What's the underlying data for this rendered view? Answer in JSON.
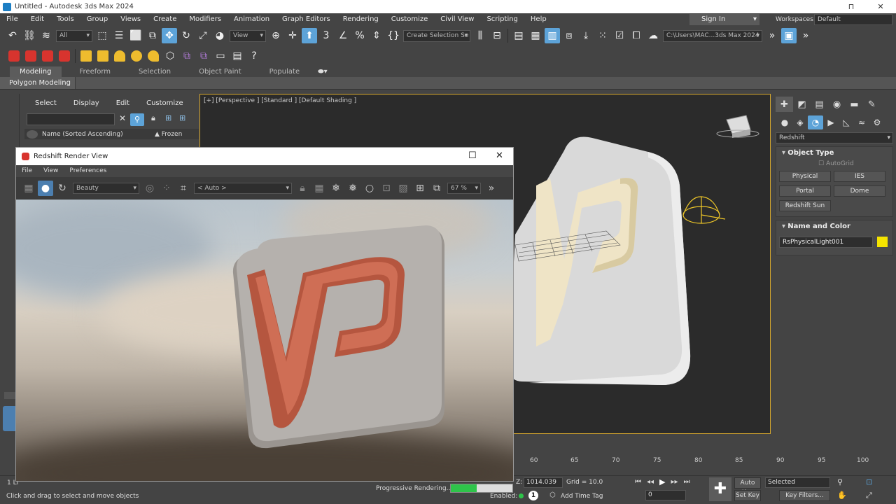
{
  "window": {
    "title": "Untitled - Autodesk 3ds Max 2024",
    "minimize": "⊓",
    "close": "✕"
  },
  "menu": {
    "items": [
      "File",
      "Edit",
      "Tools",
      "Group",
      "Views",
      "Create",
      "Modifiers",
      "Animation",
      "Graph Editors",
      "Rendering",
      "Customize",
      "Civil View",
      "Scripting",
      "Help"
    ],
    "sign_in": "Sign In",
    "workspaces_label": "Workspaces:",
    "workspaces_value": "Default"
  },
  "toolbar": {
    "selection_filter": "All",
    "ref_coord": "View",
    "named_selection": "Create Selection Se",
    "project_path": "C:\\Users\\MAC...3ds Max 2024"
  },
  "ribbon": {
    "tabs": [
      "Modeling",
      "Freeform",
      "Selection",
      "Object Paint",
      "Populate"
    ],
    "panel_label": "Polygon Modeling"
  },
  "explorer": {
    "menu": [
      "Select",
      "Display",
      "Edit",
      "Customize"
    ],
    "col_name": "Name (Sorted Ascending)",
    "col_frozen": "▲ Frozen"
  },
  "viewport": {
    "label": "[+] [Perspective ] [Standard ] [Default Shading ]"
  },
  "command_panel": {
    "category": "Redshift",
    "object_type_title": "Object Type",
    "autogrid": "AutoGrid",
    "buttons": [
      "Physical",
      "IES",
      "Portal",
      "Dome",
      "Redshift Sun"
    ],
    "name_color_title": "Name and Color",
    "object_name": "RsPhysicalLight001",
    "color": "#f5e400"
  },
  "render_view": {
    "title": "Redshift Render View",
    "menu": [
      "File",
      "View",
      "Preferences"
    ],
    "aov": "Beauty",
    "camera": "< Auto >",
    "zoom": "67 %",
    "progress_label": "Progressive Rendering...",
    "progress": 0.42
  },
  "timeline": {
    "ticks": [
      "60",
      "65",
      "70",
      "75",
      "80",
      "85",
      "90",
      "95",
      "100"
    ]
  },
  "status": {
    "selected_count": "1 Li",
    "prompt": "Click and drag to select and move objects",
    "z_label": "Z:",
    "z_value": "1014.039",
    "grid": "Grid = 10.0",
    "enabled_label": "Enabled:",
    "add_time_tag": "Add Time Tag",
    "frame": "0",
    "auto_key": "Auto Key",
    "set_key": "Set Key",
    "key_mode": "Selected",
    "key_filters": "Key Filters..."
  }
}
